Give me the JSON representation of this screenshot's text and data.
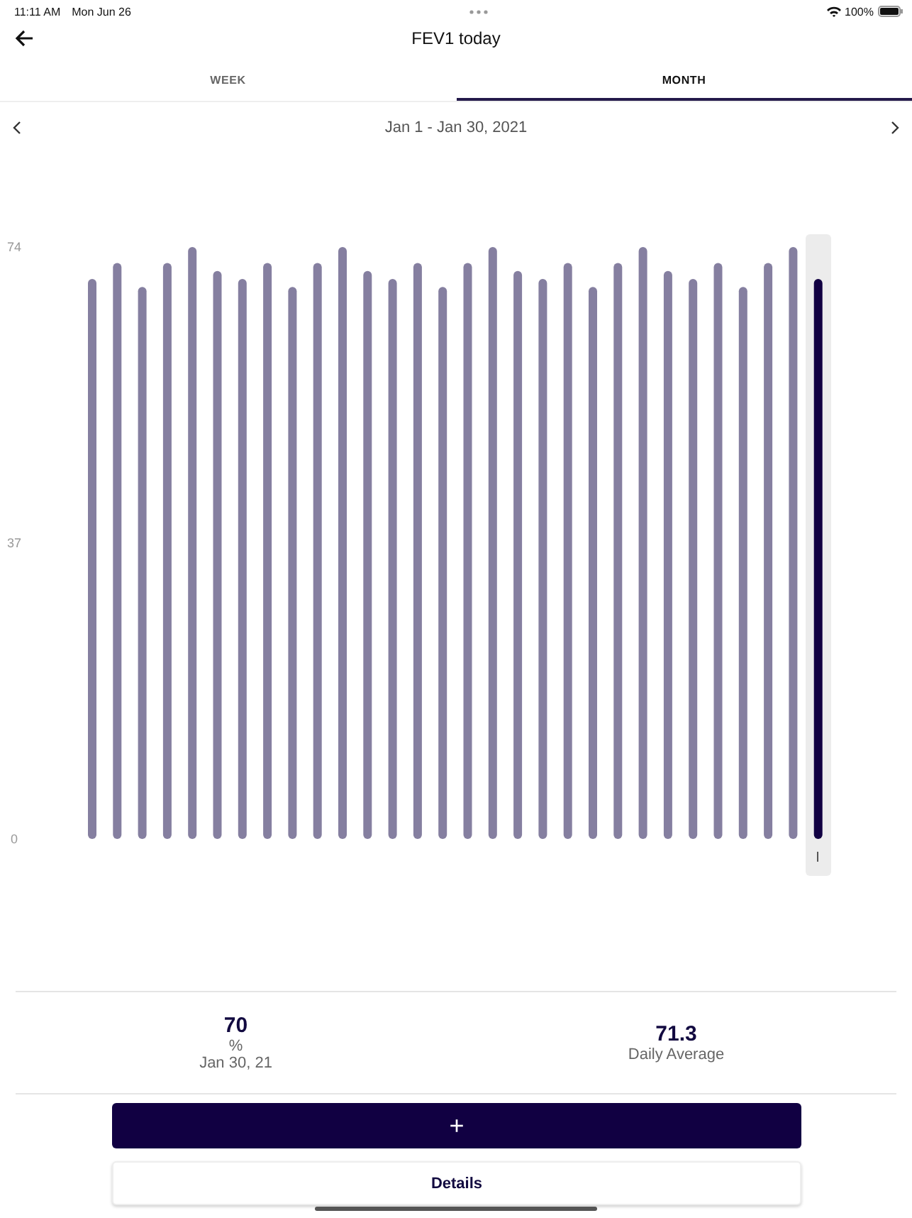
{
  "status_bar": {
    "time": "11:11 AM",
    "date": "Mon Jun 26",
    "battery": "100%"
  },
  "header": {
    "title": "FEV1 today"
  },
  "tabs": [
    {
      "label": "WEEK",
      "selected": false
    },
    {
      "label": "MONTH",
      "selected": true
    }
  ],
  "range": {
    "label": "Jan 1 - Jan 30, 2021"
  },
  "chart_data": {
    "type": "bar",
    "ylim": [
      0,
      74
    ],
    "yticks": [
      0,
      37,
      74
    ],
    "categories": [
      null,
      null,
      null,
      null,
      null,
      null,
      null,
      null,
      null,
      null,
      null,
      null,
      null,
      null,
      null,
      null,
      null,
      null,
      null,
      null,
      null,
      null,
      null,
      null,
      null,
      null,
      null,
      null,
      null,
      null
    ],
    "stacked": true,
    "series": [
      {
        "color": "#857fa0",
        "values": [
          70,
          72,
          69,
          72,
          74,
          71,
          70,
          72,
          69,
          72,
          74,
          71,
          70,
          72,
          69,
          72,
          74,
          71,
          70,
          72,
          69,
          72,
          74,
          71,
          70,
          72,
          69,
          72,
          74,
          null
        ]
      },
      {
        "color": "#110042",
        "values": [
          null,
          null,
          null,
          null,
          null,
          null,
          null,
          null,
          null,
          null,
          null,
          null,
          null,
          null,
          null,
          null,
          null,
          null,
          null,
          null,
          null,
          null,
          null,
          null,
          null,
          null,
          null,
          null,
          null,
          70
        ]
      }
    ]
  },
  "stats": [
    {
      "value": "70",
      "unit": "%",
      "caption": "Jan 30, 21"
    },
    {
      "value": "71.3",
      "caption": "Daily Average"
    }
  ],
  "buttons": {
    "add": "+",
    "details": "Details"
  }
}
